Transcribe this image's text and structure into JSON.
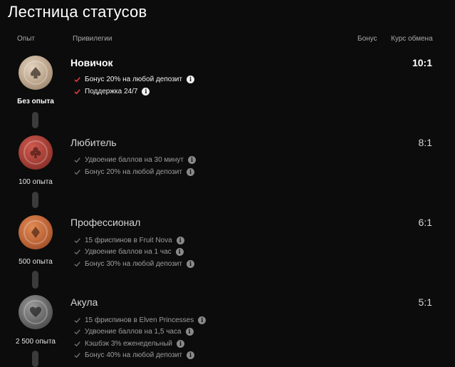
{
  "page": {
    "title": "Лестница статусов"
  },
  "columns": {
    "experience": "Опыт",
    "privileges": "Привилегии",
    "bonus": "Бонус",
    "rate": "Курс обмена"
  },
  "colors": {
    "accent": "#e03a3a",
    "chip_novice": "#c9b8a4",
    "chip_amateur": "#b0433a",
    "chip_pro": "#c76b3c",
    "chip_shark": "#6b6b6b"
  },
  "tiers": [
    {
      "name": "Новичок",
      "experience": "Без опыта",
      "rate": "10:1",
      "suit_icon": "spade-icon",
      "perks": [
        "Бонус 20% на любой депозит",
        "Поддержка 24/7"
      ]
    },
    {
      "name": "Любитель",
      "experience": "100 опыта",
      "rate": "8:1",
      "suit_icon": "club-icon",
      "perks": [
        "Удвоение баллов на 30 минут",
        "Бонус 20% на любой депозит"
      ]
    },
    {
      "name": "Профессионал",
      "experience": "500 опыта",
      "rate": "6:1",
      "suit_icon": "diamond-icon",
      "perks": [
        "15 фриспинов в Fruit Nova",
        "Удвоение баллов на 1 час",
        "Бонус 30% на любой депозит"
      ]
    },
    {
      "name": "Акула",
      "experience": "2 500 опыта",
      "rate": "5:1",
      "suit_icon": "heart-icon",
      "perks": [
        "15 фриспинов в Elven Princesses",
        "Удвоение баллов на 1,5 часа",
        "Кэшбэк 3% еженедельный",
        "Бонус 40% на любой депозит"
      ]
    }
  ]
}
